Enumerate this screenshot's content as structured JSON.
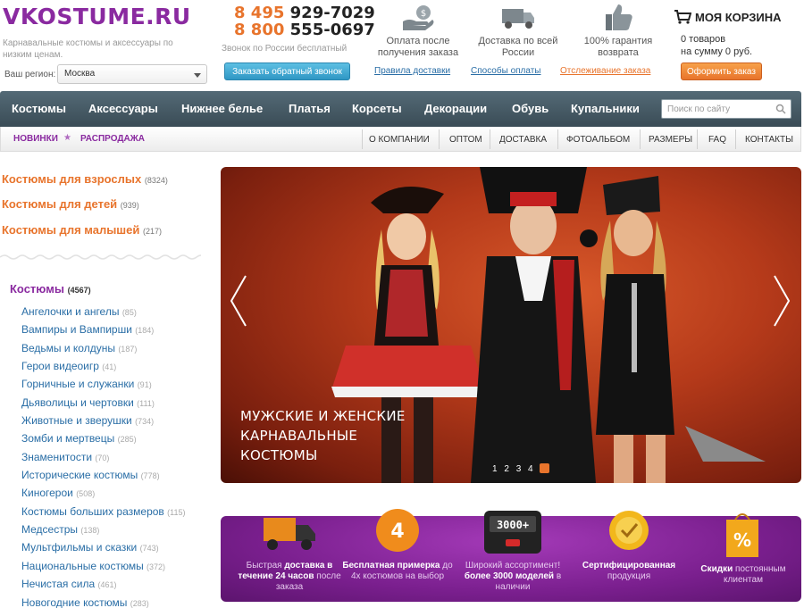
{
  "header": {
    "logo": "VKOSTUME.RU",
    "tagline": "Карнавальные костюмы и аксессуары по низким ценам.",
    "region_label": "Ваш регион:",
    "region_value": "Москва",
    "phone1_code": "8 495",
    "phone1_number": "929-7029",
    "phone2_code": "8 800",
    "phone2_number": "555-0697",
    "free_call": "Звонок по России бесплатный",
    "callback_button": "Заказать обратный звонок",
    "features": [
      {
        "text": "Оплата после получения заказа",
        "icon": "money-hand-icon"
      },
      {
        "text": "Доставка по всей России",
        "icon": "truck-icon"
      },
      {
        "text": "100% гарантия возврата",
        "icon": "thumbs-up-icon"
      }
    ],
    "feature_links": [
      "Правила доставки",
      "Способы оплаты",
      "Отслеживание заказа"
    ],
    "cart_title": "МОЯ КОРЗИНА",
    "cart_line1": "0 товаров",
    "cart_line2": "на сумму 0 руб.",
    "order_button": "Оформить заказ"
  },
  "main_nav": {
    "items": [
      "Костюмы",
      "Аксессуары",
      "Нижнее белье",
      "Платья",
      "Корсеты",
      "Декорации",
      "Обувь",
      "Купальники"
    ],
    "search_placeholder": "Поиск по сайту"
  },
  "sub_nav": {
    "promo": [
      "НОВИНКИ",
      "РАСПРОДАЖА"
    ],
    "links": [
      "О КОМПАНИИ",
      "ОПТОМ",
      "ДОСТАВКА",
      "ФОТОАЛЬБОМ",
      "РАЗМЕРЫ",
      "FAQ",
      "КОНТАКТЫ"
    ]
  },
  "sidebar": {
    "main_categories": [
      {
        "label": "Костюмы для взрослых",
        "count": "(8324)"
      },
      {
        "label": "Костюмы для детей",
        "count": "(939)"
      },
      {
        "label": "Костюмы для малышей",
        "count": "(217)"
      }
    ],
    "section_title": "Костюмы",
    "section_count": "(4567)",
    "subcategories": [
      {
        "label": "Ангелочки и ангелы",
        "count": "(85)"
      },
      {
        "label": "Вампиры и Вампирши",
        "count": "(184)"
      },
      {
        "label": "Ведьмы и колдуны",
        "count": "(187)"
      },
      {
        "label": "Герои видеоигр",
        "count": "(41)"
      },
      {
        "label": "Горничные и служанки",
        "count": "(91)"
      },
      {
        "label": "Дьяволицы и чертовки",
        "count": "(111)"
      },
      {
        "label": "Животные и зверушки",
        "count": "(734)"
      },
      {
        "label": "Зомби и мертвецы",
        "count": "(285)"
      },
      {
        "label": "Знаменитости",
        "count": "(70)"
      },
      {
        "label": "Исторические костюмы",
        "count": "(778)"
      },
      {
        "label": "Киногерои",
        "count": "(508)"
      },
      {
        "label": "Костюмы больших размеров",
        "count": "(115)"
      },
      {
        "label": "Медсестры",
        "count": "(138)"
      },
      {
        "label": "Мультфильмы и сказки",
        "count": "(743)"
      },
      {
        "label": "Национальные костюмы",
        "count": "(372)"
      },
      {
        "label": "Нечистая сила",
        "count": "(461)"
      },
      {
        "label": "Новогодние костюмы",
        "count": "(283)"
      }
    ]
  },
  "banner": {
    "caption_line1": "МУЖСКИЕ И ЖЕНСКИЕ",
    "caption_line2": "КАРНАВАЛЬНЫЕ",
    "caption_line3": "КОСТЮМЫ",
    "pages": [
      "1",
      "2",
      "3",
      "4"
    ],
    "active_page": 5
  },
  "promo_strip": {
    "items": [
      {
        "pre": "Быстрая ",
        "bold": "доставка в течение 24 часов",
        "post": " после заказа",
        "icon": "delivery-truck-icon"
      },
      {
        "pre": "",
        "bold": "Бесплатная примерка",
        "post": " до 4х костюмов на выбор",
        "icon": "number-4-badge-icon",
        "badge": "4"
      },
      {
        "pre": "Широкий ассортимент! ",
        "bold": "более 3000 моделей",
        "post": " в наличии",
        "icon": "counter-icon",
        "badge": "3000+"
      },
      {
        "pre": "",
        "bold": "Сертифицированная",
        "post": " продукция",
        "icon": "certificate-icon"
      },
      {
        "pre": "",
        "bold": "Скидки",
        "post": " постоянным клиентам",
        "icon": "discount-bag-icon"
      }
    ]
  }
}
